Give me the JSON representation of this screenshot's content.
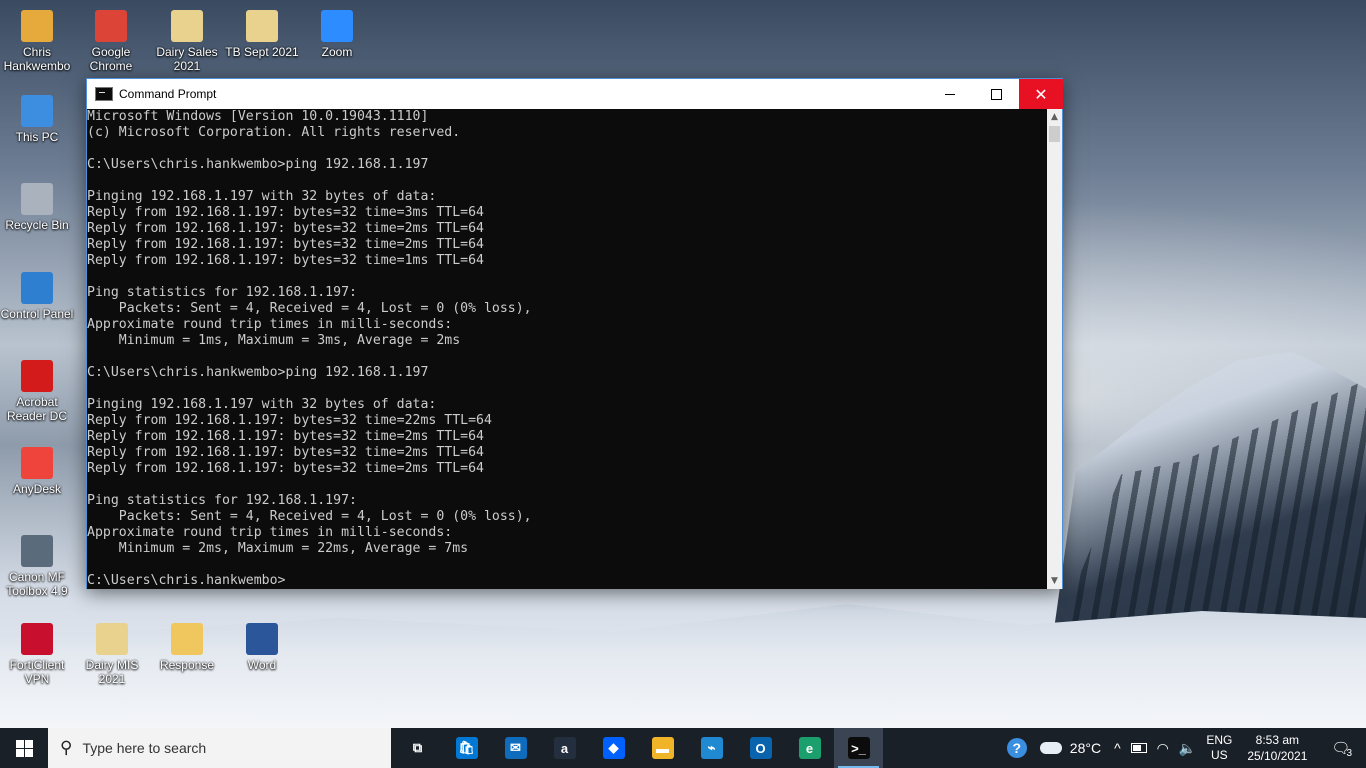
{
  "desktop": {
    "icons": [
      {
        "label": "Chris Hankwembo",
        "icon": "user-folder-icon",
        "color": "#e6a93b"
      },
      {
        "label": "Google Chrome",
        "icon": "chrome-icon",
        "color": "#db4437"
      },
      {
        "label": "Dairy Sales 2021",
        "icon": "excel-folder-icon",
        "color": "#e9d28d"
      },
      {
        "label": "TB Sept 2021",
        "icon": "excel-folder-icon",
        "color": "#e9d28d"
      },
      {
        "label": "Zoom",
        "icon": "zoom-icon",
        "color": "#2d8cff"
      },
      {
        "label": "This PC",
        "icon": "computer-icon",
        "color": "#3d8ee0"
      },
      {
        "label": "Recycle Bin",
        "icon": "recycle-bin-icon",
        "color": "#aab3bd"
      },
      {
        "label": "Control Panel",
        "icon": "control-panel-icon",
        "color": "#2f7fd0"
      },
      {
        "label": "Acrobat Reader DC",
        "icon": "acrobat-icon",
        "color": "#d41b1b"
      },
      {
        "label": "AnyDesk",
        "icon": "anydesk-icon",
        "color": "#ef443b"
      },
      {
        "label": "Canon MF Toolbox 4.9",
        "icon": "printer-icon",
        "color": "#5a6b7c"
      },
      {
        "label": "FortiClient VPN",
        "icon": "forticlient-icon",
        "color": "#c8102e"
      },
      {
        "label": "Dairy MIS 2021",
        "icon": "excel-folder-icon",
        "color": "#e9d28d"
      },
      {
        "label": "Response",
        "icon": "folder-icon",
        "color": "#f0c75e"
      },
      {
        "label": "Word",
        "icon": "word-icon",
        "color": "#2b579a"
      }
    ]
  },
  "window": {
    "title": "Command Prompt",
    "minimize_symbol": "",
    "close_symbol": "✕",
    "console_lines": [
      "Microsoft Windows [Version 10.0.19043.1110]",
      "(c) Microsoft Corporation. All rights reserved.",
      "",
      "C:\\Users\\chris.hankwembo>ping 192.168.1.197",
      "",
      "Pinging 192.168.1.197 with 32 bytes of data:",
      "Reply from 192.168.1.197: bytes=32 time=3ms TTL=64",
      "Reply from 192.168.1.197: bytes=32 time=2ms TTL=64",
      "Reply from 192.168.1.197: bytes=32 time=2ms TTL=64",
      "Reply from 192.168.1.197: bytes=32 time=1ms TTL=64",
      "",
      "Ping statistics for 192.168.1.197:",
      "    Packets: Sent = 4, Received = 4, Lost = 0 (0% loss),",
      "Approximate round trip times in milli-seconds:",
      "    Minimum = 1ms, Maximum = 3ms, Average = 2ms",
      "",
      "C:\\Users\\chris.hankwembo>ping 192.168.1.197",
      "",
      "Pinging 192.168.1.197 with 32 bytes of data:",
      "Reply from 192.168.1.197: bytes=32 time=22ms TTL=64",
      "Reply from 192.168.1.197: bytes=32 time=2ms TTL=64",
      "Reply from 192.168.1.197: bytes=32 time=2ms TTL=64",
      "Reply from 192.168.1.197: bytes=32 time=2ms TTL=64",
      "",
      "Ping statistics for 192.168.1.197:",
      "    Packets: Sent = 4, Received = 4, Lost = 0 (0% loss),",
      "Approximate round trip times in milli-seconds:",
      "    Minimum = 2ms, Maximum = 22ms, Average = 7ms",
      "",
      "C:\\Users\\chris.hankwembo>"
    ]
  },
  "taskbar": {
    "search_placeholder": "Type here to search",
    "apps": [
      {
        "name": "task-view",
        "icon": "task-view-icon",
        "glyph": "⧉",
        "color": "#1a2028"
      },
      {
        "name": "microsoft-store",
        "icon": "store-icon",
        "glyph": "🛍",
        "color": "#0078d4"
      },
      {
        "name": "mail",
        "icon": "mail-icon",
        "glyph": "✉",
        "color": "#0f6cbd"
      },
      {
        "name": "amazon",
        "icon": "amazon-icon",
        "glyph": "a",
        "color": "#232f3e"
      },
      {
        "name": "dropbox",
        "icon": "dropbox-icon",
        "glyph": "◆",
        "color": "#0061ff"
      },
      {
        "name": "file-explorer",
        "icon": "folder-icon",
        "glyph": "▬",
        "color": "#f0b429"
      },
      {
        "name": "visual-studio",
        "icon": "visual-studio-icon",
        "glyph": "⌁",
        "color": "#1f8ad2"
      },
      {
        "name": "outlook",
        "icon": "outlook-icon",
        "glyph": "O",
        "color": "#0a64ad"
      },
      {
        "name": "edge",
        "icon": "edge-icon",
        "glyph": "e",
        "color": "#1ba06d"
      },
      {
        "name": "command-prompt",
        "icon": "cmd-icon",
        "glyph": ">_",
        "color": "#0c0c0c"
      }
    ],
    "tray": {
      "help_glyph": "?",
      "temperature": "28°C",
      "chevron": "^",
      "language_top": "ENG",
      "language_bottom": "US",
      "time": "8:53 am",
      "date": "25/10/2021",
      "notification_count": "3"
    }
  }
}
